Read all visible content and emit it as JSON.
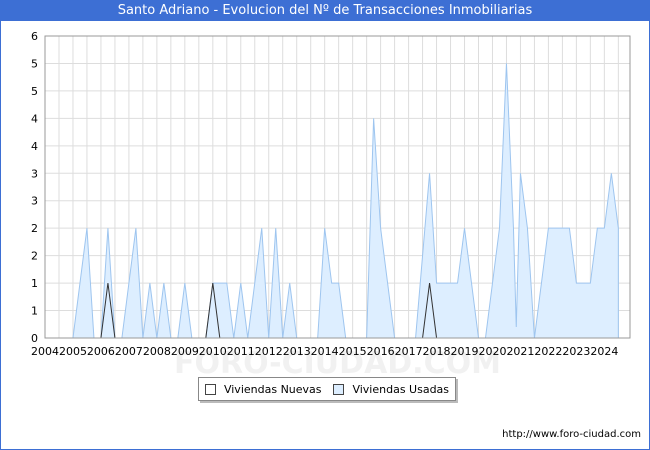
{
  "chart_data": {
    "type": "area",
    "title": "Santo Adriano - Evolucion del Nº de Transacciones Inmobiliarias",
    "xlabel": "",
    "ylabel": "",
    "x_tick_labels": [
      "2004",
      "2005",
      "2006",
      "2007",
      "2008",
      "2009",
      "2010",
      "2011",
      "2012",
      "2013",
      "2014",
      "2015",
      "2016",
      "2017",
      "2018",
      "2019",
      "2020",
      "2021",
      "2022",
      "2023",
      "2024"
    ],
    "y_tick_labels": [
      "0",
      "1",
      "1",
      "2",
      "2",
      "3",
      "3",
      "4",
      "4",
      "5",
      "5",
      "6"
    ],
    "x_range": [
      2004.0,
      2024.917
    ],
    "ylim": [
      0,
      5.5
    ],
    "grid": true,
    "legend_position": "bottom-center",
    "series": [
      {
        "name": "Viviendas Nuevas",
        "color": "#ffffff",
        "points": [
          [
            2006.0,
            0
          ],
          [
            2006.25,
            1
          ],
          [
            2006.5,
            0
          ],
          [
            2009.75,
            0
          ],
          [
            2010.0,
            1
          ],
          [
            2010.25,
            0
          ],
          [
            2017.5,
            0
          ],
          [
            2017.75,
            1
          ],
          [
            2018.0,
            0
          ]
        ]
      },
      {
        "name": "Viviendas Usadas",
        "color": "#ddeeff",
        "points": [
          [
            2005.0,
            0
          ],
          [
            2005.5,
            2
          ],
          [
            2005.75,
            0
          ],
          [
            2006.0,
            0
          ],
          [
            2006.25,
            2
          ],
          [
            2006.5,
            0
          ],
          [
            2006.75,
            0
          ],
          [
            2007.25,
            2
          ],
          [
            2007.5,
            0
          ],
          [
            2007.75,
            1
          ],
          [
            2008.0,
            0
          ],
          [
            2008.25,
            1
          ],
          [
            2008.5,
            0
          ],
          [
            2008.75,
            0
          ],
          [
            2009.0,
            1
          ],
          [
            2009.25,
            0
          ],
          [
            2009.75,
            0
          ],
          [
            2010.0,
            1
          ],
          [
            2010.5,
            1
          ],
          [
            2010.75,
            0
          ],
          [
            2011.0,
            1
          ],
          [
            2011.25,
            0
          ],
          [
            2011.75,
            2
          ],
          [
            2012.0,
            0
          ],
          [
            2012.25,
            2
          ],
          [
            2012.5,
            0
          ],
          [
            2012.75,
            1
          ],
          [
            2013.0,
            0
          ],
          [
            2013.75,
            0
          ],
          [
            2014.0,
            2
          ],
          [
            2014.25,
            1
          ],
          [
            2014.5,
            1
          ],
          [
            2014.75,
            0
          ],
          [
            2015.5,
            0
          ],
          [
            2015.75,
            4
          ],
          [
            2016.0,
            2
          ],
          [
            2016.5,
            0
          ],
          [
            2017.25,
            0
          ],
          [
            2017.75,
            3
          ],
          [
            2018.0,
            1
          ],
          [
            2018.75,
            1
          ],
          [
            2019.0,
            2
          ],
          [
            2019.5,
            0
          ],
          [
            2019.75,
            0
          ],
          [
            2020.25,
            2
          ],
          [
            2020.5,
            5
          ],
          [
            2020.75,
            2
          ],
          [
            2020.85,
            0.2
          ],
          [
            2021.0,
            3
          ],
          [
            2021.25,
            2
          ],
          [
            2021.5,
            0
          ],
          [
            2021.75,
            1
          ],
          [
            2022.0,
            2
          ],
          [
            2022.75,
            2
          ],
          [
            2023.0,
            1
          ],
          [
            2023.5,
            1
          ],
          [
            2023.75,
            2
          ],
          [
            2024.0,
            2
          ],
          [
            2024.25,
            3
          ],
          [
            2024.5,
            2
          ]
        ]
      }
    ]
  },
  "footer": {
    "url": "http://www.foro-ciudad.com"
  },
  "watermark": "FORO-CIUDAD.COM"
}
